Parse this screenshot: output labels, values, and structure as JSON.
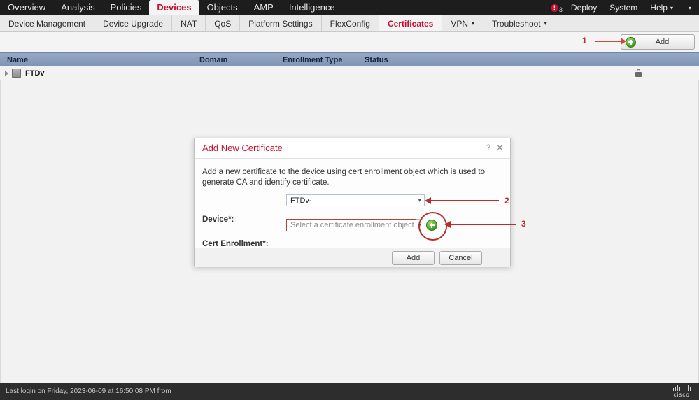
{
  "topnav": {
    "items": [
      {
        "label": "Overview",
        "active": false
      },
      {
        "label": "Analysis",
        "active": false
      },
      {
        "label": "Policies",
        "active": false
      },
      {
        "label": "Devices",
        "active": true
      },
      {
        "label": "Objects",
        "active": false
      },
      {
        "label": "AMP",
        "active": false
      },
      {
        "label": "Intelligence",
        "active": false
      }
    ],
    "deploy_badge_glyph": "!",
    "deploy_badge_count": "3",
    "deploy_label": "Deploy",
    "system_label": "System",
    "help_label": "Help",
    "caret": "▾"
  },
  "subnav": {
    "items": [
      {
        "label": "Device Management",
        "active": false,
        "caret": ""
      },
      {
        "label": "Device Upgrade",
        "active": false,
        "caret": ""
      },
      {
        "label": "NAT",
        "active": false,
        "caret": ""
      },
      {
        "label": "QoS",
        "active": false,
        "caret": ""
      },
      {
        "label": "Platform Settings",
        "active": false,
        "caret": ""
      },
      {
        "label": "FlexConfig",
        "active": false,
        "caret": ""
      },
      {
        "label": "Certificates",
        "active": true,
        "caret": ""
      },
      {
        "label": "VPN",
        "active": false,
        "caret": "▾"
      },
      {
        "label": "Troubleshoot",
        "active": false,
        "caret": "▾"
      }
    ]
  },
  "toolbar": {
    "add_label": "Add"
  },
  "table": {
    "columns": [
      "Name",
      "Domain",
      "Enrollment Type",
      "Status"
    ],
    "rows": [
      {
        "name": "FTDv",
        "domain": "",
        "enrollment_type": "",
        "status": ""
      }
    ]
  },
  "modal": {
    "title": "Add New Certificate",
    "help_glyph": "?",
    "close_glyph": "✕",
    "description": "Add a new certificate to the device using cert enrollment object which is used to generate CA and identify certificate.",
    "device_label": "Device*:",
    "device_value": "FTDv-",
    "cert_label": "Cert Enrollment*:",
    "cert_placeholder": "Select a certificate enrollment object",
    "select_caret": "▾",
    "add_button": "Add",
    "cancel_button": "Cancel"
  },
  "annotations": [
    {
      "number": "1",
      "target": "add-button"
    },
    {
      "number": "2",
      "target": "device-select"
    },
    {
      "number": "3",
      "target": "cert-enrollment-add-icon"
    }
  ],
  "footer": {
    "last_login": "Last login on Friday, 2023-06-09 at 16:50:08 PM from",
    "brand": "cisco"
  },
  "colors": {
    "accent_red": "#c8102e",
    "annotation_red": "#b5302a",
    "table_header_blue": "#8599b8",
    "nav_dark": "#1d1d1d"
  }
}
